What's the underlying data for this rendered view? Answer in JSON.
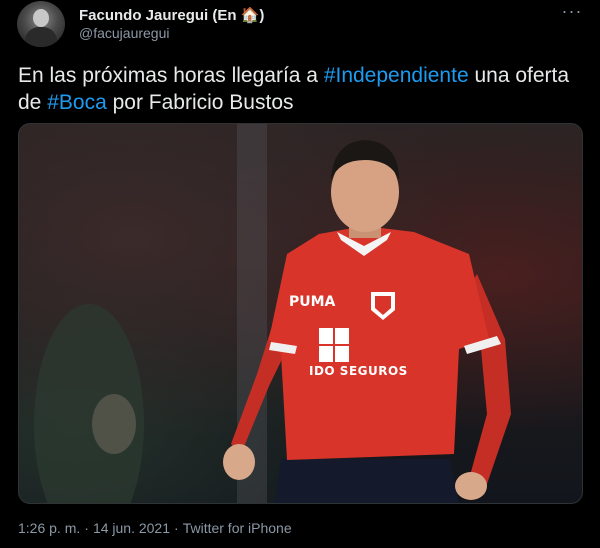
{
  "tweet": {
    "author_name": "Facundo Jauregui (En 🏠)",
    "author_handle": "@facujauregui",
    "text_part1": "En las próximas horas llegaría a ",
    "hashtag1": "#Independiente",
    "text_part2": " una oferta de ",
    "hashtag2": "#Boca",
    "text_part3": " por Fabricio Bustos",
    "timestamp_time": "1:26 p. m.",
    "separator": "·",
    "timestamp_date": "14 jun. 2021",
    "source": "Twitter for iPhone",
    "more_icon": "more-dots-icon"
  },
  "media": {
    "jersey_text": "IDO SEGUROS",
    "colors": {
      "jersey": "#d8342a",
      "link": "#1d9bf0",
      "background": "#000000"
    }
  }
}
